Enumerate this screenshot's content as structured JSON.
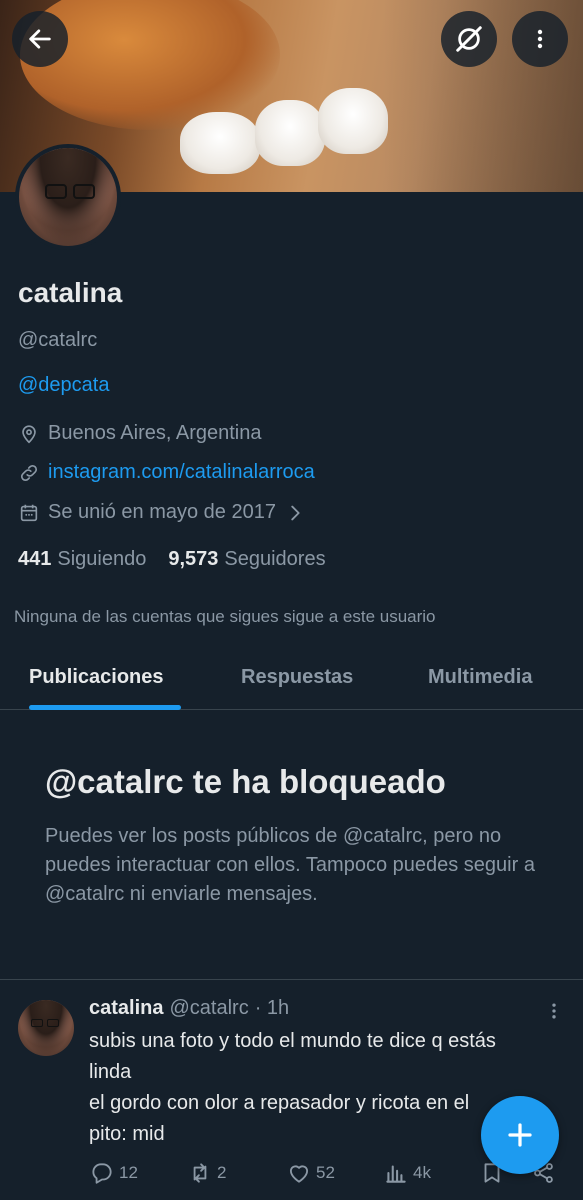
{
  "header": {
    "back_icon": "arrow-left-icon",
    "grok_icon": "slash-circle-icon",
    "more_icon": "vertical-dots-icon"
  },
  "profile": {
    "name": "catalina",
    "handle": "@catalrc",
    "bio_link": "@depcata",
    "location": "Buenos Aires, Argentina",
    "website": "instagram.com/catalinalarroca",
    "joined": "Se unió en mayo de 2017",
    "following_count": "441",
    "following_label": "Siguiendo",
    "followers_count": "9,573",
    "followers_label": "Seguidores",
    "followed_by_note": "Ninguna de las cuentas que sigues sigue a este usuario"
  },
  "tabs": [
    {
      "label": "Publicaciones",
      "active": true
    },
    {
      "label": "Respuestas",
      "active": false
    },
    {
      "label": "Multimedia",
      "active": false
    }
  ],
  "blocked": {
    "title": "@catalrc te ha bloqueado",
    "message": "Puedes ver los posts públicos de @catalrc, pero no puedes interactuar con ellos. Tampoco puedes seguir a @catalrc ni enviarle mensajes."
  },
  "post": {
    "name": "catalina",
    "handle": "@catalrc",
    "time": "· 1h",
    "text_line1": "subis una foto y todo el mundo te dice q estás",
    "text_line2": "linda",
    "text_line3": "el gordo con olor a repasador y ricota en el",
    "text_line4": "pito: mid",
    "replies": "12",
    "reposts": "2",
    "likes": "52",
    "views": "4k"
  },
  "colors": {
    "background": "#15202b",
    "accent": "#1d9bf0",
    "muted": "#8b98a5",
    "text": "#e7e9ea"
  }
}
